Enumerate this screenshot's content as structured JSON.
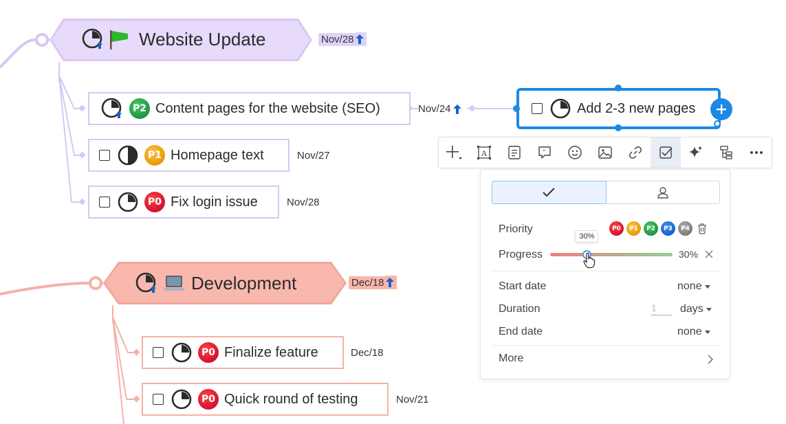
{
  "topics": {
    "website_update": {
      "title": "Website Update",
      "date": "Nov/28"
    },
    "development": {
      "title": "Development",
      "date": "Dec/18"
    }
  },
  "subtopics": {
    "content_pages": {
      "priority": "P2",
      "label": "Content pages for the website (SEO)",
      "date": "Nov/24"
    },
    "homepage_text": {
      "priority": "P1",
      "label": "Homepage text",
      "date": "Nov/27"
    },
    "fix_login": {
      "priority": "P0",
      "label": "Fix login issue",
      "date": "Nov/28"
    },
    "add_pages": {
      "label": "Add 2-3 new pages"
    },
    "finalize_feature": {
      "priority": "P0",
      "label": "Finalize feature",
      "date": "Dec/18"
    },
    "quick_testing": {
      "priority": "P0",
      "label": "Quick round of testing",
      "date": "Nov/21"
    }
  },
  "toolbar": {
    "icons": [
      "add-icon",
      "text-box-icon",
      "note-icon",
      "comment-icon",
      "emoji-icon",
      "image-icon",
      "link-icon",
      "task-icon",
      "ai-sparkle-icon",
      "structure-icon",
      "more-icon"
    ]
  },
  "task_panel": {
    "priority_label": "Priority",
    "priority_options": [
      "P0",
      "P1",
      "P2",
      "P3",
      "P4"
    ],
    "progress_label": "Progress",
    "progress_value": 0.3,
    "progress_text": "30%",
    "progress_tooltip": "30%",
    "start_date_label": "Start date",
    "start_date_value": "none",
    "duration_label": "Duration",
    "duration_value": "1",
    "duration_unit": "days",
    "end_date_label": "End date",
    "end_date_value": "none",
    "more_label": "More"
  },
  "colors": {
    "purple_branch": "#d8c7f3",
    "red_branch": "#f4b1a7",
    "selection_blue": "#1e88e5",
    "progress_start": "#f07f7f",
    "progress_end": "#8fd18f"
  }
}
